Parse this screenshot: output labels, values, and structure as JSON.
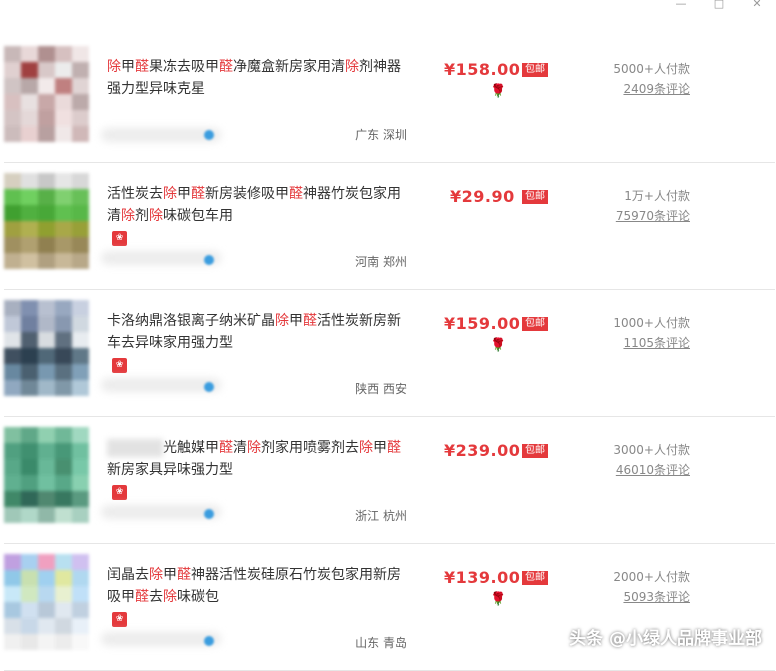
{
  "window": {
    "minimize": "—",
    "maximize": "□",
    "close": "✕"
  },
  "items": [
    {
      "title_parts": [
        {
          "t": "除",
          "h": true
        },
        {
          "t": "甲",
          "h": false
        },
        {
          "t": "醛",
          "h": true
        },
        {
          "t": "果冻去吸甲",
          "h": false
        },
        {
          "t": "醛",
          "h": true
        },
        {
          "t": "净魔盒新房家用清",
          "h": false
        },
        {
          "t": "除",
          "h": true
        },
        {
          "t": "剂神器强力型异味克星",
          "h": false
        }
      ],
      "price": "¥158.00",
      "tag": "包邮",
      "paid": "5000+人付款",
      "reviews": "2409条评论",
      "location": "广东  深圳",
      "has_rose": true,
      "has_badge": false
    },
    {
      "title_parts": [
        {
          "t": "活性炭去",
          "h": false
        },
        {
          "t": "除",
          "h": true
        },
        {
          "t": "甲",
          "h": false
        },
        {
          "t": "醛",
          "h": true
        },
        {
          "t": "新房装修吸甲",
          "h": false
        },
        {
          "t": "醛",
          "h": true
        },
        {
          "t": "神器竹炭包家用清",
          "h": false
        },
        {
          "t": "除",
          "h": true
        },
        {
          "t": "剂",
          "h": false
        },
        {
          "t": "除",
          "h": true
        },
        {
          "t": "味碳包车用",
          "h": false
        }
      ],
      "price": "¥29.90",
      "tag": "包邮",
      "paid": "1万+人付款",
      "reviews": "75970条评论",
      "location": "河南  郑州",
      "has_rose": false,
      "has_badge": true
    },
    {
      "title_parts": [
        {
          "t": "卡洛纳鼎洛银离子纳米矿晶",
          "h": false
        },
        {
          "t": "除",
          "h": true
        },
        {
          "t": "甲",
          "h": false
        },
        {
          "t": "醛",
          "h": true
        },
        {
          "t": "活性炭新房新车去异味家用强力型",
          "h": false
        }
      ],
      "price": "¥159.00",
      "tag": "包邮",
      "paid": "1000+人付款",
      "reviews": "1105条评论",
      "location": "陕西  西安",
      "has_rose": true,
      "has_badge": true
    },
    {
      "title_parts": [
        {
          "t": "光触媒甲",
          "h": false
        },
        {
          "t": "醛",
          "h": true
        },
        {
          "t": "清",
          "h": false
        },
        {
          "t": "除",
          "h": true
        },
        {
          "t": "剂家用喷雾剂去",
          "h": false
        },
        {
          "t": "除",
          "h": true
        },
        {
          "t": "甲",
          "h": false
        },
        {
          "t": "醛",
          "h": true
        },
        {
          "t": "新房家具异味强力型",
          "h": false
        }
      ],
      "title_prefix_blur": true,
      "price": "¥239.00",
      "tag": "包邮",
      "paid": "3000+人付款",
      "reviews": "46010条评论",
      "location": "浙江  杭州",
      "has_rose": false,
      "has_badge": true
    },
    {
      "title_parts": [
        {
          "t": "闰晶去",
          "h": false
        },
        {
          "t": "除",
          "h": true
        },
        {
          "t": "甲",
          "h": false
        },
        {
          "t": "醛",
          "h": true
        },
        {
          "t": "神器活性炭硅原石竹炭包家用新房吸甲",
          "h": false
        },
        {
          "t": "醛",
          "h": true
        },
        {
          "t": "去",
          "h": false
        },
        {
          "t": "除",
          "h": true
        },
        {
          "t": "味碳包",
          "h": false
        }
      ],
      "price": "¥139.00",
      "tag": "包邮",
      "paid": "2000+人付款",
      "reviews": "5093条评论",
      "location": "山东  青岛",
      "has_rose": true,
      "has_badge": true
    }
  ],
  "icons": {
    "rose": "🌹",
    "shop_badge": "❀"
  },
  "watermark": "头条 @小绿人品牌事业部",
  "colors": {
    "accent": "#e4393c",
    "muted": "#888888"
  }
}
